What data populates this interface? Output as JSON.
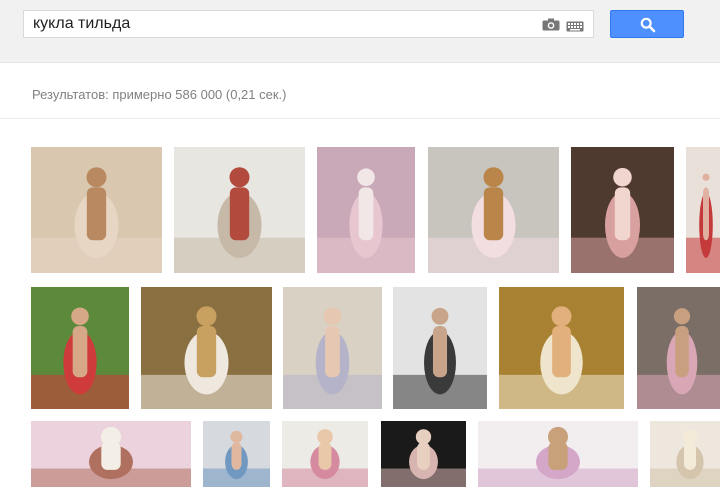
{
  "search": {
    "query": "кукла тильда"
  },
  "icons": {
    "camera": "camera-icon",
    "keyboard": "keyboard-icon",
    "search": "search-icon"
  },
  "stats": {
    "text": "Результатов: примерно 586 000 (0,21 сек.)"
  },
  "colors": {
    "accent": "#4d90fe",
    "topbar": "#f1f1f1",
    "stats_text": "#808080"
  },
  "images": [
    {
      "id": "r1c1",
      "bg": "#d9c7b0",
      "accent": "#e8d6c4",
      "figure": "#b98a62"
    },
    {
      "id": "r1c2",
      "bg": "#e8e6e1",
      "accent": "#c7b9a8",
      "figure": "#b24a3e"
    },
    {
      "id": "r1c3",
      "bg": "#c9a8b8",
      "accent": "#e7c6d0",
      "figure": "#f1e7e6"
    },
    {
      "id": "r1c4",
      "bg": "#c8c4be",
      "accent": "#f2dde0",
      "figure": "#b98548"
    },
    {
      "id": "r1c5",
      "bg": "#4f3a30",
      "accent": "#d9a0a0",
      "figure": "#f0d6cf"
    },
    {
      "id": "r1c6",
      "bg": "#e9e1d9",
      "accent": "#c43a3a",
      "figure": "#e0b0a0"
    },
    {
      "id": "r2c1",
      "bg": "#5d8a3a",
      "accent": "#cf3b3b",
      "figure": "#d6a888"
    },
    {
      "id": "r2c2",
      "bg": "#8a7040",
      "accent": "#efe8df",
      "figure": "#c8a060"
    },
    {
      "id": "r2c3",
      "bg": "#d9d2c4",
      "accent": "#b4b3c9",
      "figure": "#e6c8b2"
    },
    {
      "id": "r2c4",
      "bg": "#e3e3e3",
      "accent": "#3a3a3a",
      "figure": "#c8a58a"
    },
    {
      "id": "r2c5",
      "bg": "#a88232",
      "accent": "#efe4cc",
      "figure": "#e2b07d"
    },
    {
      "id": "r2c6",
      "bg": "#7a6e66",
      "accent": "#d8a6b4",
      "figure": "#c8a080"
    },
    {
      "id": "r3c1",
      "bg": "#ecd2dc",
      "accent": "#b07060",
      "figure": "#f3efe6"
    },
    {
      "id": "r3c2",
      "bg": "#d6d9de",
      "accent": "#7098c0",
      "figure": "#e0b8a0"
    },
    {
      "id": "r3c3",
      "bg": "#ecebe6",
      "accent": "#d58aa0",
      "figure": "#e8c8a8"
    },
    {
      "id": "r3c4",
      "bg": "#1a1a1a",
      "accent": "#d8b4b0",
      "figure": "#e8d0c0"
    },
    {
      "id": "r3c5",
      "bg": "#f2eef0",
      "accent": "#d4a6c8",
      "figure": "#c8a07a"
    },
    {
      "id": "r3c6",
      "bg": "#ede7dd",
      "accent": "#d4c5ac",
      "figure": "#f3ead8"
    }
  ]
}
